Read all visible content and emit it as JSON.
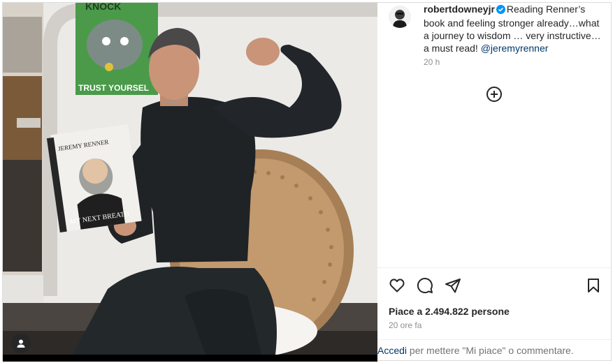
{
  "post": {
    "username": "robertdowneyjr",
    "caption_text": "Reading Renner’s book and feeling stronger already…what a journey to  wisdom … very instructive…a must read!",
    "mention": "@jeremyrenner",
    "time_ago": "20 h"
  },
  "photo": {
    "poster_top_text": "KNOCK",
    "poster_bottom_text": "TRUST YOURSEL",
    "book_author": "JEREMY RENNER",
    "book_title": "MY NEXT BREATH"
  },
  "engagement": {
    "likes_label": "Piace a 2.494.822 persone",
    "posted_label": "20 ore fa"
  },
  "footer": {
    "login_link": "Accedi",
    "login_text": " per mettere \"Mi piace\" o commentare."
  },
  "colors": {
    "verified": "#0095f6",
    "link": "#00376b",
    "muted": "#8e8e8e"
  },
  "icons": [
    "heart-icon",
    "comment-icon",
    "share-icon",
    "bookmark-icon",
    "plus-circle-icon",
    "user-tag-icon",
    "verified-badge-icon"
  ]
}
